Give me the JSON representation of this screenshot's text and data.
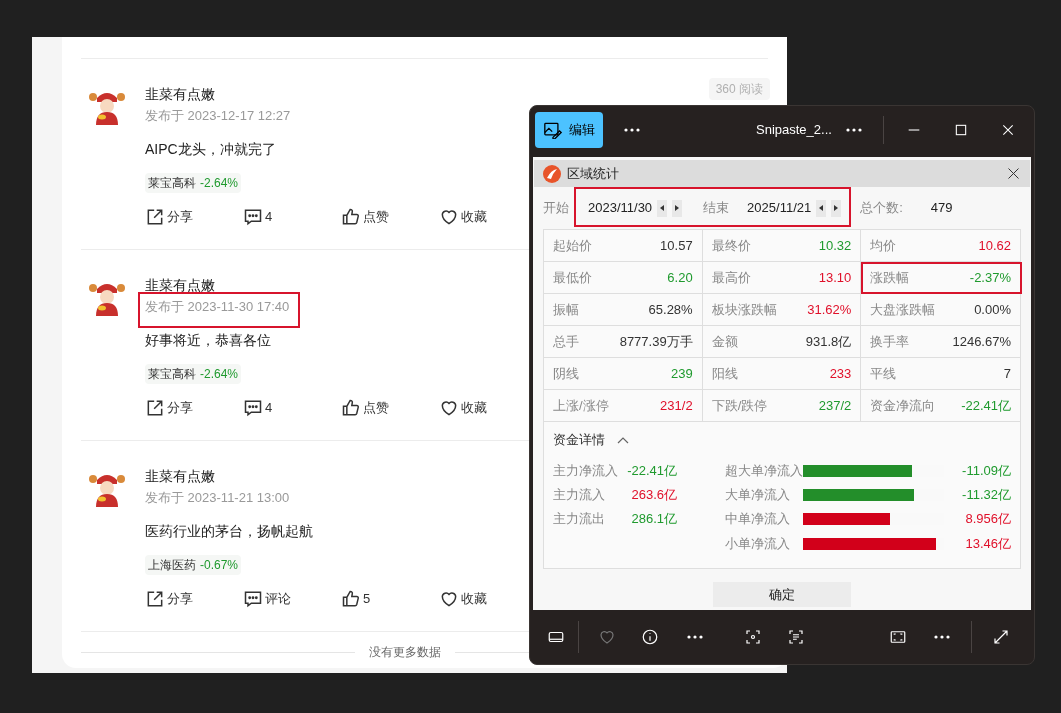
{
  "feed": {
    "posts": [
      {
        "author": "韭菜有点嫩",
        "time": "发布于 2023-12-17 12:27",
        "views": "360 阅读",
        "content": "AIPC龙头，冲就完了",
        "stock": {
          "name": "莱宝高科",
          "change": "-2.64%",
          "color": "#1f9a2e"
        },
        "actions": [
          {
            "kind": "share",
            "label": "分享"
          },
          {
            "kind": "comment",
            "label": "4"
          },
          {
            "kind": "like",
            "label": "点赞"
          },
          {
            "kind": "favorite",
            "label": "收藏"
          }
        ]
      },
      {
        "author": "韭菜有点嫩",
        "time": "发布于 2023-11-30 17:40",
        "time_highlighted": true,
        "content": "好事将近，恭喜各位",
        "stock": {
          "name": "莱宝高科",
          "change": "-2.64%",
          "color": "#1f9a2e"
        },
        "actions": [
          {
            "kind": "share",
            "label": "分享"
          },
          {
            "kind": "comment",
            "label": "4"
          },
          {
            "kind": "like",
            "label": "点赞"
          },
          {
            "kind": "favorite",
            "label": "收藏"
          }
        ]
      },
      {
        "author": "韭菜有点嫩",
        "time": "发布于 2023-11-21 13:00",
        "content": "医药行业的茅台，扬帆起航",
        "stock": {
          "name": "上海医药",
          "change": "-0.67%",
          "color": "#1f9a2e"
        },
        "actions": [
          {
            "kind": "share",
            "label": "分享"
          },
          {
            "kind": "comment",
            "label": "评论"
          },
          {
            "kind": "like",
            "label": "5"
          },
          {
            "kind": "favorite",
            "label": "收藏"
          }
        ]
      }
    ],
    "footer": "没有更多数据"
  },
  "viewer": {
    "edit_label": "编辑",
    "title": "Snipaste_2...",
    "dialog": {
      "title": "区域统计",
      "range": {
        "start_label": "开始",
        "start": "2023/11/30",
        "end_label": "结束",
        "end": "2025/11/21",
        "highlighted": true
      },
      "count_label": "总个数:",
      "count": "479",
      "stats": [
        [
          {
            "label": "起始价",
            "value": "10.57",
            "color": "#333333"
          },
          {
            "label": "最终价",
            "value": "10.32",
            "color": "#1f9a2e"
          },
          {
            "label": "均价",
            "value": "10.62",
            "color": "#e0102a"
          }
        ],
        [
          {
            "label": "最低价",
            "value": "6.20",
            "color": "#1f9a2e"
          },
          {
            "label": "最高价",
            "value": "13.10",
            "color": "#e0102a"
          },
          {
            "label": "涨跌幅",
            "value": "-2.37%",
            "color": "#1f9a2e",
            "highlighted": true
          }
        ],
        [
          {
            "label": "振幅",
            "value": "65.28%",
            "color": "#333333"
          },
          {
            "label": "板块涨跌幅",
            "value": "31.62%",
            "color": "#e0102a"
          },
          {
            "label": "大盘涨跌幅",
            "value": "0.00%",
            "color": "#333333"
          }
        ],
        [
          {
            "label": "总手",
            "value": "8777.39万手",
            "color": "#333333"
          },
          {
            "label": "金额",
            "value": "931.8亿",
            "color": "#333333"
          },
          {
            "label": "换手率",
            "value": "1246.67%",
            "color": "#333333"
          }
        ],
        [
          {
            "label": "阴线",
            "value": "239",
            "color": "#1f9a2e"
          },
          {
            "label": "阳线",
            "value": "233",
            "color": "#e0102a"
          },
          {
            "label": "平线",
            "value": "7",
            "color": "#333333"
          }
        ],
        [
          {
            "label": "上涨/涨停",
            "value": "231/2",
            "color": "#e0102a"
          },
          {
            "label": "下跌/跌停",
            "value": "237/2",
            "color": "#1f9a2e"
          },
          {
            "label": "资金净流向",
            "value": "-22.41亿",
            "color": "#1f9a2e"
          }
        ]
      ],
      "detail": {
        "title": "资金详情",
        "expanded": true,
        "summary": [
          {
            "label": "主力净流入",
            "value": "-22.41亿",
            "color": "#1f9a2e"
          },
          {
            "label": "主力流入",
            "value": "263.6亿",
            "color": "#e0102a"
          },
          {
            "label": "主力流出",
            "value": "286.1亿",
            "color": "#1f9a2e"
          }
        ],
        "flows": [
          {
            "label": "超大单净流入",
            "level": 0.77,
            "color": "#238e2a",
            "value": "-11.09亿"
          },
          {
            "label": "大单净流入",
            "level": 0.79,
            "color": "#238e2a",
            "value": "-11.32亿"
          },
          {
            "label": "中单净流入",
            "level": 0.62,
            "color": "#d2001a",
            "value": "8.956亿"
          },
          {
            "label": "小单净流入",
            "level": 0.94,
            "color": "#d2001a",
            "value": "13.46亿"
          }
        ]
      },
      "confirm": "确定"
    }
  }
}
